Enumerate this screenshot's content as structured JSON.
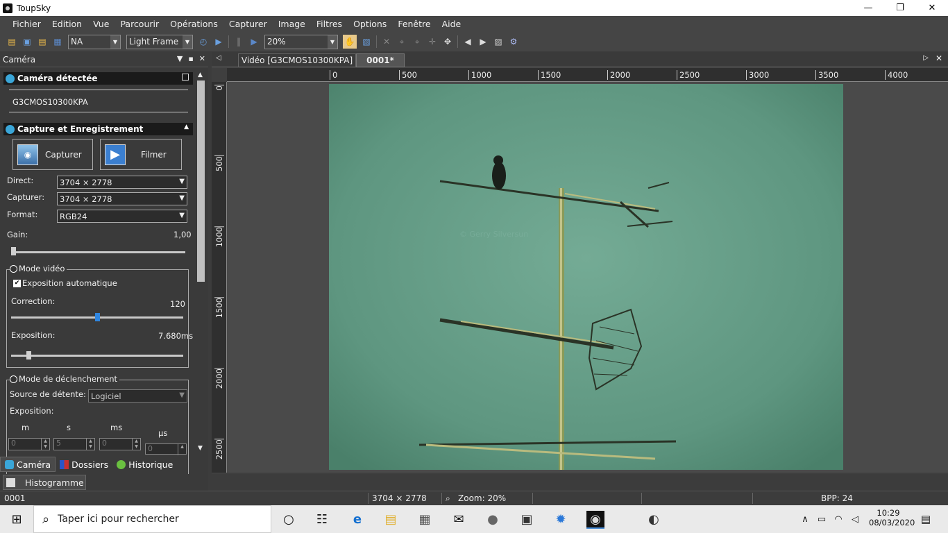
{
  "window": {
    "title": "ToupSky"
  },
  "menu": [
    "Fichier",
    "Edition",
    "Vue",
    "Parcourir",
    "Opérations",
    "Capturer",
    "Image",
    "Filtres",
    "Options",
    "Fenêtre",
    "Aide"
  ],
  "toolbar": {
    "camera_select": "NA",
    "frame_type": "Light Frame",
    "zoom": "20%"
  },
  "panel": {
    "title": "Caméra",
    "camera_section": {
      "title": "Caméra détectée",
      "camera_name": "G3CMOS10300KPA"
    },
    "capture_section": {
      "title": "Capture et Enregistrement",
      "capture_button": "Capturer",
      "record_button": "Filmer",
      "direct_label": "Direct:",
      "direct_value": "3704 × 2778",
      "capture_label": "Capturer:",
      "capture_value": "3704 × 2778",
      "format_label": "Format:",
      "format_value": "RGB24",
      "gain_label": "Gain:",
      "gain_value": "1,00",
      "gain_level": 0.0
    },
    "video_mode": {
      "title": "Mode vidéo",
      "auto_exposure_label": "Exposition automatique",
      "auto_exposure_checked": true,
      "correction_label": "Correction:",
      "correction_value": "120",
      "correction_level": 0.5,
      "exposure_label": "Exposition:",
      "exposure_value": "7.680ms",
      "exposure_level": 0.1
    },
    "trigger_mode": {
      "title": "Mode de déclenchement",
      "source_label": "Source de détente:",
      "source_value": "Logiciel",
      "exposure_label": "Exposition:",
      "units": [
        "m",
        "s",
        "ms",
        "µs"
      ],
      "values": [
        "0",
        "5",
        "0",
        "0"
      ]
    },
    "tabs": [
      "Caméra",
      "Dossiers",
      "Historique"
    ],
    "bottom_tab": "Histogramme"
  },
  "document": {
    "tabs": [
      "Vidéo [G3CMOS10300KPA]",
      "0001*"
    ],
    "ruler_x": [
      "0",
      "500",
      "1000",
      "1500",
      "2000",
      "2500",
      "3000",
      "3500",
      "4000"
    ],
    "ruler_y": [
      "0",
      "500",
      "1000",
      "1500",
      "2000",
      "2500"
    ],
    "watermark": "© Gerry Silversun"
  },
  "status": {
    "name": "0001",
    "size": "3704 × 2778",
    "zoom": "Zoom: 20%",
    "bpp": "BPP: 24"
  },
  "taskbar": {
    "search_placeholder": "Taper ici pour rechercher",
    "time": "10:29",
    "date": "08/03/2020"
  }
}
